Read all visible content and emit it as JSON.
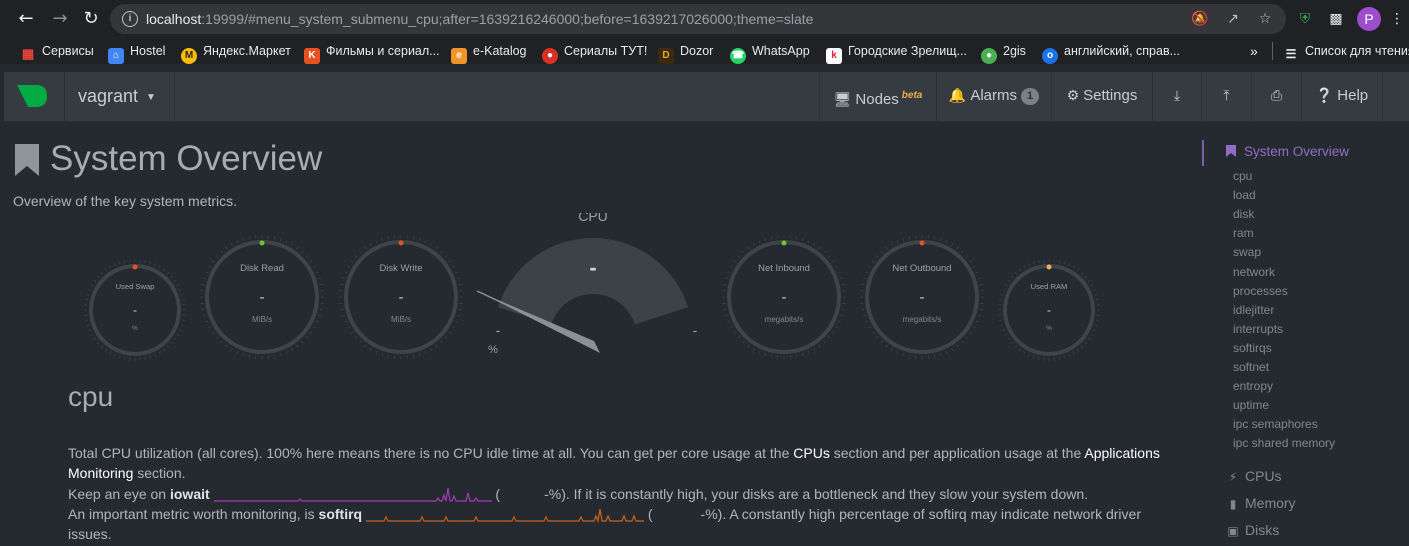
{
  "browser": {
    "url_host": "localhost",
    "url_rest": ":19999/#menu_system_submenu_cpu;after=1639216246000;before=1639217026000;theme=slate",
    "profile_initial": "P",
    "bookmarks": [
      {
        "label": "Сервисы",
        "color": "#e8eaed"
      },
      {
        "label": "Hostel",
        "color": "#4285f4"
      },
      {
        "label": "Яндекс.Маркет",
        "color": "#fbbc04"
      },
      {
        "label": "Фильмы и сериал...",
        "color": "#e8501f"
      },
      {
        "label": "e-Katalog",
        "color": "#f29527"
      },
      {
        "label": "Сериалы ТУТ!",
        "color": "#d93025"
      },
      {
        "label": "Dozor",
        "color": "#f7a825"
      },
      {
        "label": "WhatsApp",
        "color": "#25d366"
      },
      {
        "label": "Городские Зрелищ...",
        "color": "#d7263d"
      },
      {
        "label": "2gis",
        "color": "#4caf50"
      },
      {
        "label": "английский, справ...",
        "color": "#1a73e8"
      }
    ],
    "more_label": "»",
    "reading_list_label": "Список для чтения"
  },
  "navbar": {
    "host": "vagrant",
    "nodes_label": "Nodes",
    "beta_label": "beta",
    "alarms_label": "Alarms",
    "alarms_count": "1",
    "settings_label": "Settings",
    "help_label": "Help"
  },
  "page": {
    "title": "System Overview",
    "subtitle": "Overview of the key system metrics."
  },
  "gauges": [
    {
      "name": "used-swap",
      "title": "Used Swap",
      "value": "-",
      "unit": "%",
      "dot": "#e5531f",
      "size": "small"
    },
    {
      "name": "disk-read",
      "title": "Disk Read",
      "value": "-",
      "unit": "MiB/s",
      "dot": "#77c12d",
      "size": "medium"
    },
    {
      "name": "disk-write",
      "title": "Disk Write",
      "value": "-",
      "unit": "MiB/s",
      "dot": "#e5531f",
      "size": "medium"
    },
    {
      "name": "net-inbound",
      "title": "Net Inbound",
      "value": "-",
      "unit": "megabits/s",
      "dot": "#77c12d",
      "size": "medium"
    },
    {
      "name": "net-outbound",
      "title": "Net Outbound",
      "value": "-",
      "unit": "megabits/s",
      "dot": "#e5531f",
      "size": "medium"
    },
    {
      "name": "used-ram",
      "title": "Used RAM",
      "value": "-",
      "unit": "%",
      "dot": "#f0ad4e",
      "size": "small"
    }
  ],
  "cpu_gauge": {
    "title": "CPU",
    "value": "-",
    "min_label": "-",
    "max_label": "-",
    "unit": "%"
  },
  "section": {
    "title": "cpu",
    "para1_a": "Total CPU utilization (all cores). 100% here means there is no CPU idle time at all. You can get per core usage at the ",
    "para1_link1": "CPUs",
    "para1_b": " section and per application usage at the ",
    "para1_link2": "Applications Monitoring",
    "para1_c": " section.",
    "para2_a": "Keep an eye on ",
    "para2_metric": "iowait",
    "para2_paren": " (",
    "para2_b": "-%). If it is constantly high, your disks are a bottleneck and they slow your system down.",
    "para3_a": "An important metric worth monitoring, is ",
    "para3_metric": "softirq",
    "para3_paren": " (",
    "para3_b": "-%). A constantly high percentage of softirq may indicate network driver issues.",
    "iowait_color": "#a33ab5",
    "softirq_color": "#c8631c"
  },
  "sidebar": {
    "heading": "System Overview",
    "items": [
      "cpu",
      "load",
      "disk",
      "ram",
      "swap",
      "network",
      "processes",
      "idlejitter",
      "interrupts",
      "softirqs",
      "softnet",
      "entropy",
      "uptime",
      "ipc semaphores",
      "ipc shared memory"
    ],
    "groups": [
      {
        "label": "CPUs",
        "icon": "bolt-icon"
      },
      {
        "label": "Memory",
        "icon": "memory-icon"
      },
      {
        "label": "Disks",
        "icon": "hdd-icon"
      }
    ]
  }
}
